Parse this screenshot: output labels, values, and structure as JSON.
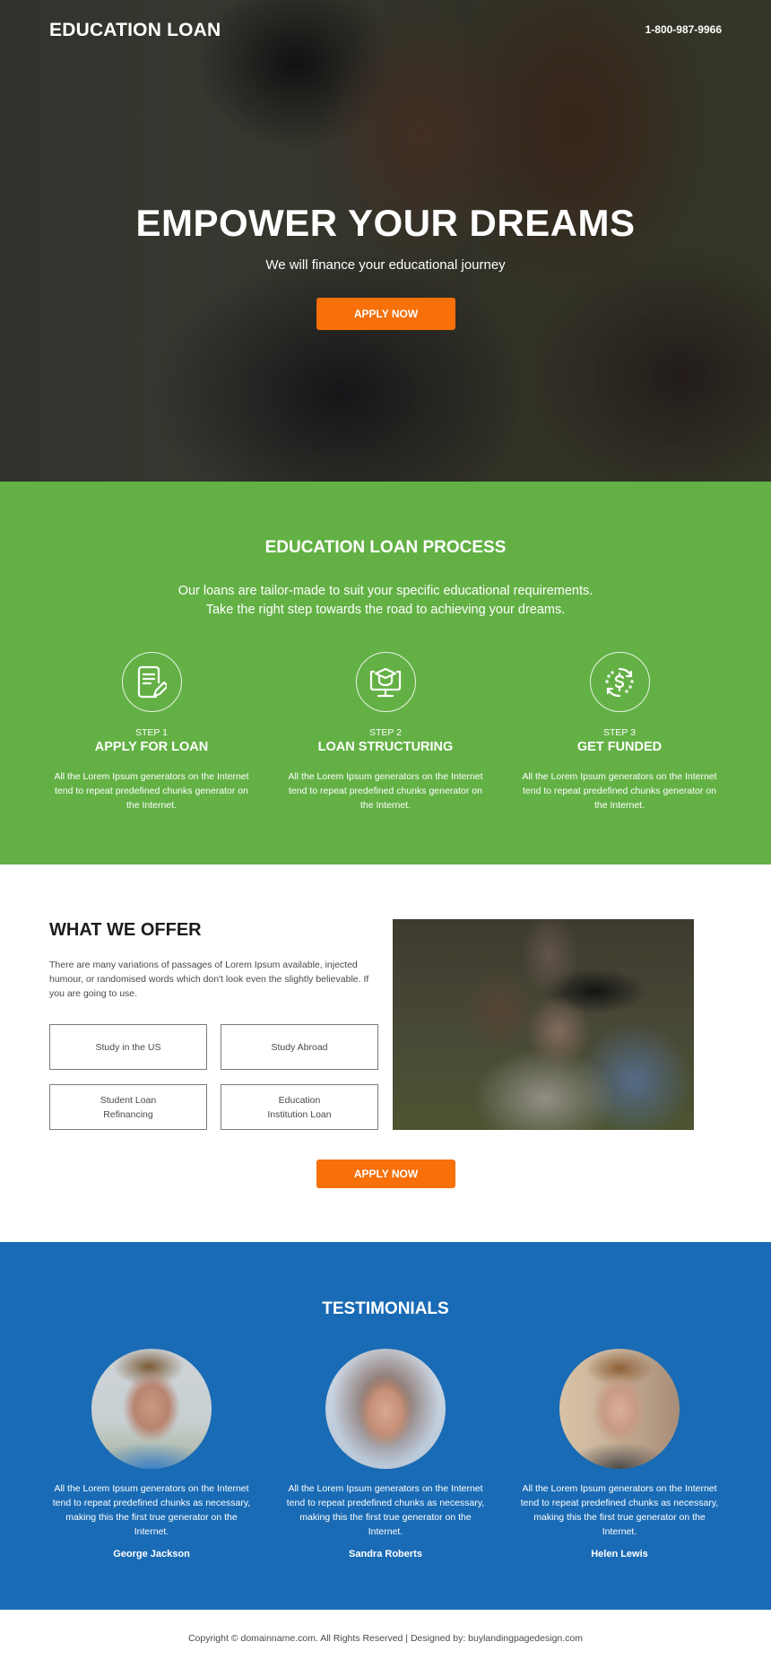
{
  "header": {
    "logo": "EDUCATION LOAN",
    "phone": "1-800-987-9966"
  },
  "hero": {
    "title": "EMPOWER YOUR DREAMS",
    "subtitle": "We will finance your educational journey",
    "cta_label": "APPLY NOW"
  },
  "process": {
    "title": "EDUCATION LOAN PROCESS",
    "intro_line1": "Our loans are tailor-made to suit your specific educational requirements.",
    "intro_line2": "Take the right step towards the road to achieving your dreams.",
    "steps": [
      {
        "icon": "document-edit-icon",
        "number": "STEP 1",
        "name": "APPLY FOR LOAN",
        "description": "All the Lorem Ipsum generators on the Internet tend to repeat predefined chunks generator on the Internet."
      },
      {
        "icon": "graduation-monitor-icon",
        "number": "STEP 2",
        "name": "LOAN STRUCTURING",
        "description": "All the Lorem Ipsum generators on the Internet tend to repeat predefined chunks generator on the Internet."
      },
      {
        "icon": "dollar-exchange-icon",
        "number": "STEP 3",
        "name": "GET FUNDED",
        "description": "All the Lorem Ipsum generators on the Internet tend to repeat predefined chunks generator on the Internet."
      }
    ]
  },
  "offer": {
    "title": "WHAT WE OFFER",
    "description": "There are many variations of passages of Lorem Ipsum available, injected humour, or randomised words which don't look even the slightly believable. If you are going to use.",
    "options": [
      {
        "line1": "Study in the US",
        "line2": ""
      },
      {
        "line1": "Study Abroad",
        "line2": ""
      },
      {
        "line1": "Student Loan",
        "line2": "Refinancing"
      },
      {
        "line1": "Education",
        "line2": "Institution Loan"
      }
    ],
    "cta_label": "APPLY NOW"
  },
  "testimonials": {
    "title": "TESTIMONIALS",
    "items": [
      {
        "text": "All the Lorem Ipsum generators on the Internet tend to repeat predefined chunks as necessary, making this the first true generator on the Internet.",
        "name": "George Jackson"
      },
      {
        "text": "All the Lorem Ipsum generators on the Internet tend to repeat predefined chunks as necessary, making this the first true generator on the Internet.",
        "name": "Sandra Roberts"
      },
      {
        "text": "All the Lorem Ipsum generators on the Internet tend to repeat predefined chunks as necessary, making this the first true generator on the Internet.",
        "name": "Helen Lewis"
      }
    ]
  },
  "footer": {
    "copyright": "Copyright © domainname.com. All Rights Reserved | Designed by: buylandingpagedesign.com"
  },
  "colors": {
    "accent_orange": "#f7700a",
    "process_green": "#63b145",
    "testimonial_blue": "#1a6bb5"
  }
}
